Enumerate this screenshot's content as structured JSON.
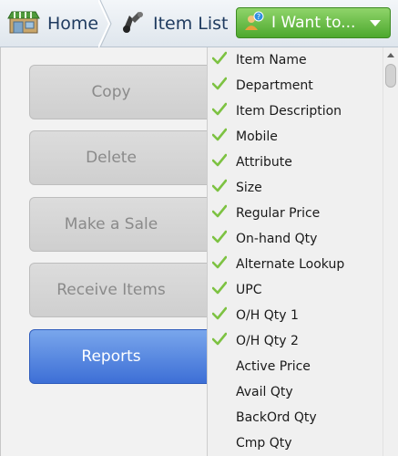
{
  "breadcrumb": {
    "home_label": "Home",
    "item_list_label": "Item List",
    "home_icon": "store-icon",
    "item_list_icon": "binoculars-icon"
  },
  "want_menu": {
    "label": "I Want to...",
    "icon": "users-icon",
    "accent": "#4da82e"
  },
  "actions": {
    "copy": "Copy",
    "delete": "Delete",
    "make_sale": "Make a Sale",
    "receive_items": "Receive Items",
    "reports": "Reports",
    "active_color": "#3d6fd6"
  },
  "columns_menu": {
    "items": [
      {
        "label": "Item Name",
        "checked": true
      },
      {
        "label": "Department",
        "checked": true
      },
      {
        "label": "Item Description",
        "checked": true
      },
      {
        "label": "Mobile",
        "checked": true
      },
      {
        "label": "Attribute",
        "checked": true
      },
      {
        "label": "Size",
        "checked": true
      },
      {
        "label": "Regular Price",
        "checked": true
      },
      {
        "label": "On-hand Qty",
        "checked": true
      },
      {
        "label": "Alternate Lookup",
        "checked": true
      },
      {
        "label": "UPC",
        "checked": true
      },
      {
        "label": "O/H Qty 1",
        "checked": true
      },
      {
        "label": "O/H Qty 2",
        "checked": true
      },
      {
        "label": "Active Price",
        "checked": false
      },
      {
        "label": "Avail Qty",
        "checked": false
      },
      {
        "label": "BackOrd Qty",
        "checked": false
      },
      {
        "label": "Cmp Qty",
        "checked": false
      }
    ],
    "check_color": "#7dc242"
  }
}
